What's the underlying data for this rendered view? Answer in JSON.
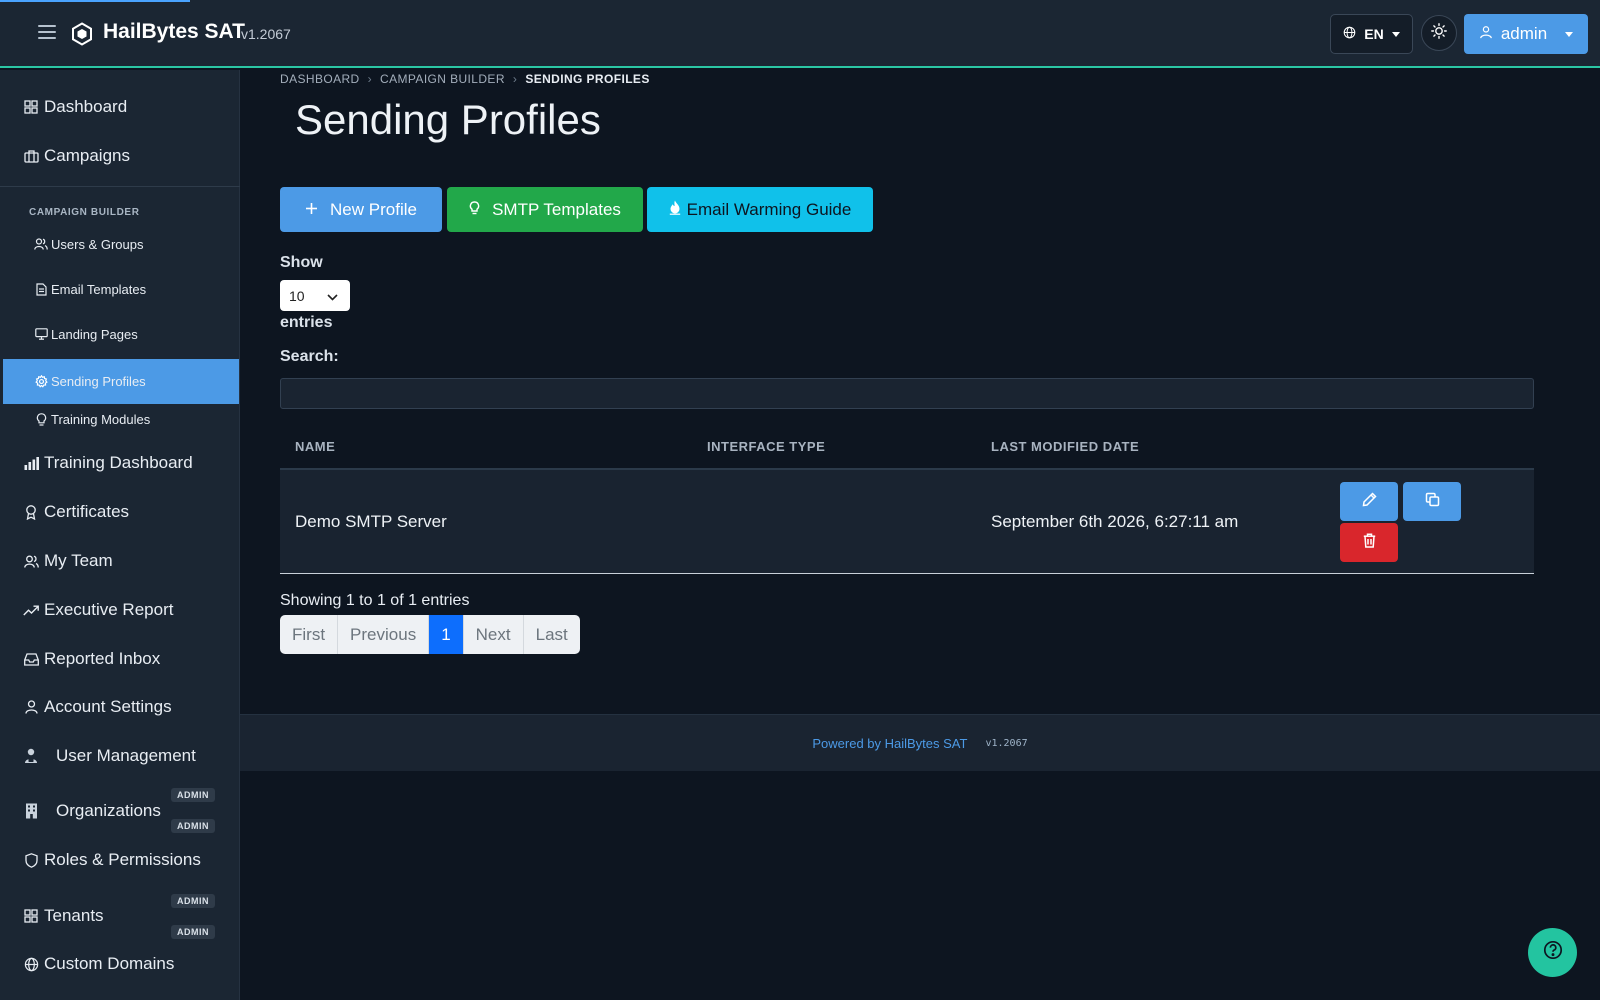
{
  "header": {
    "brand": "HailBytes SAT",
    "version": "v1.2067",
    "language": "EN",
    "user": "admin"
  },
  "sidebar": {
    "items_top": [
      {
        "label": "Dashboard",
        "icon": "grid-icon"
      },
      {
        "label": "Campaigns",
        "icon": "briefcase-icon"
      }
    ],
    "section_label": "CAMPAIGN BUILDER",
    "sub_items": [
      {
        "label": "Users & Groups",
        "icon": "users-icon"
      },
      {
        "label": "Email Templates",
        "icon": "document-icon"
      },
      {
        "label": "Landing Pages",
        "icon": "monitor-icon"
      },
      {
        "label": "Sending Profiles",
        "icon": "gear-icon",
        "active": true
      },
      {
        "label": "Training Modules",
        "icon": "bulb-icon"
      }
    ],
    "items_bottom": [
      {
        "label": "Training Dashboard",
        "icon": "bar-chart-icon"
      },
      {
        "label": "Certificates",
        "icon": "award-icon"
      },
      {
        "label": "My Team",
        "icon": "team-icon"
      },
      {
        "label": "Executive Report",
        "icon": "trend-icon"
      },
      {
        "label": "Reported Inbox",
        "icon": "inbox-icon"
      },
      {
        "label": "Account Settings",
        "icon": "user-icon"
      },
      {
        "label": "User Management",
        "icon": "user-lock-icon",
        "badge": "ADMIN"
      },
      {
        "label": "Organizations",
        "icon": "building-icon",
        "badge": "ADMIN"
      },
      {
        "label": "Roles & Permissions",
        "icon": "shield-icon",
        "badge": "ADMIN"
      },
      {
        "label": "Tenants",
        "icon": "grid-icon",
        "badge": "ADMIN"
      },
      {
        "label": "Custom Domains",
        "icon": "globe-icon"
      }
    ]
  },
  "breadcrumb": [
    "DASHBOARD",
    "CAMPAIGN BUILDER",
    "SENDING PROFILES"
  ],
  "page_title": "Sending Profiles",
  "actions": {
    "new_profile": "New Profile",
    "smtp_templates": "SMTP Templates",
    "warming_guide": "Email Warming Guide"
  },
  "table_controls": {
    "show_label": "Show",
    "entries_value": "10",
    "entries_label": "entries",
    "search_label": "Search:",
    "search_value": ""
  },
  "table": {
    "columns": [
      "NAME",
      "INTERFACE TYPE",
      "LAST MODIFIED DATE"
    ],
    "rows": [
      {
        "name": "Demo SMTP Server",
        "interface_type": "",
        "last_modified": "September 6th 2026, 6:27:11 am"
      }
    ]
  },
  "pagination": {
    "summary": "Showing 1 to 1 of 1 entries",
    "first": "First",
    "previous": "Previous",
    "current": "1",
    "next": "Next",
    "last": "Last"
  },
  "footer": {
    "powered_by": "Powered by HailBytes SAT",
    "version": "v1.2067"
  },
  "colors": {
    "primary": "#4c9ae6",
    "success": "#22a84a",
    "info": "#10c1ea",
    "danger": "#d9262c",
    "accent": "#2bc6a4"
  }
}
